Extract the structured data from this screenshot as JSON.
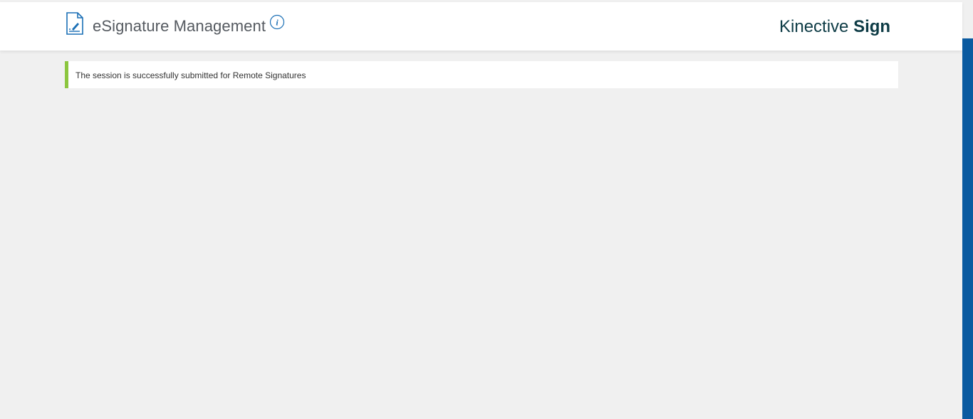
{
  "header": {
    "title": "eSignature Management",
    "brand_light": "Kinective",
    "brand_bold": "Sign",
    "doc_icon": "document-signature-icon",
    "info_icon": "info-icon"
  },
  "alert": {
    "message": "The session is successfully submitted for Remote Signatures",
    "accent_color": "#8cc63f"
  },
  "colors": {
    "background": "#f0f0f0",
    "header_bg": "#ffffff",
    "brand_text": "#0d3b45",
    "scrollbar_accent": "#0a5aa0",
    "icon_blue": "#1a6fb5"
  }
}
